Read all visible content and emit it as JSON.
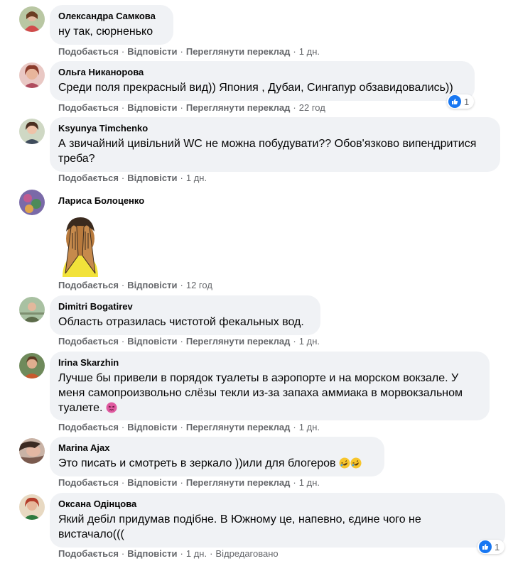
{
  "actions": {
    "like": "Подобається",
    "reply": "Відповісти",
    "translate": "Переглянути переклад",
    "edited": "Відредаговано",
    "separator": "·"
  },
  "comments": [
    {
      "author": "Олександра Самкова",
      "text": "ну так, сюрненько",
      "time": "1 дн."
    },
    {
      "author": "Ольга Никанорова",
      "text": "Среди поля прекрасный вид)) Япония , Дубаи, Сингапур обзавидовались))",
      "time": "22 год",
      "reactions": {
        "icon": "like-icon",
        "count": "1"
      }
    },
    {
      "author": "Ksyunya Timchenko",
      "text": "А звичайний цивільний WC не можна побудувати?? Обов'язково випендритися\nтреба?",
      "time": "1 дн."
    },
    {
      "author": "Лариса Болоценко",
      "sticker": "covering-face-sticker",
      "time": "12 год"
    },
    {
      "author": "Dimitri Bogatirev",
      "text": "Область отразилась чистотой фекальных вод.",
      "time": "1 дн."
    },
    {
      "author": "Irina Skarzhin",
      "text": "Лучше бы привели в порядок туалеты в аэропорте и на морском вокзале. У\nменя самопроизвольно слёзы текли из-за запаха аммиака в морвокзальном\nтуалете.",
      "time": "1 дн.",
      "emoji": "persevering-face-emoji"
    },
    {
      "author": "Marina Ajax",
      "text": "Это писать и смотреть в зеркало ))или для блогеров",
      "time": "1 дн.",
      "emoji": "rolling-laughing-emoji"
    },
    {
      "author": "Оксана Одінцова",
      "text": "Який дебіл придумав подібне. В Южному це, напевно, єдине чого не\nвистачало(((",
      "time": "1 дн.",
      "reactions": {
        "icon": "like-icon",
        "count": "1"
      }
    }
  ],
  "colors": {
    "bubble": "#f0f2f5",
    "meta": "#65676b",
    "like": "#1877f2"
  }
}
